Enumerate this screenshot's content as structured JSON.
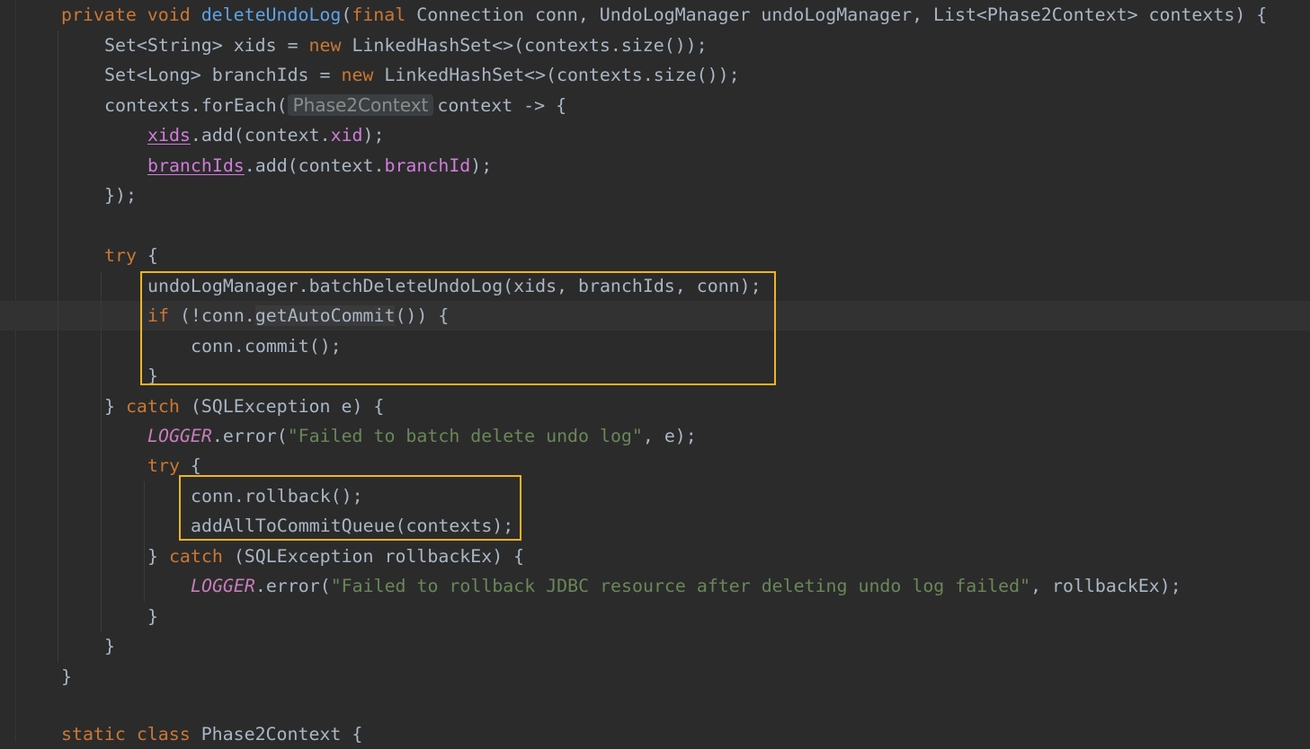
{
  "lines": {
    "l1": {
      "p1": "private void ",
      "p2": "deleteUndoLog",
      "p3": "(",
      "p4": "final ",
      "p5": "Connection conn, UndoLogManager undoLogManager, List<Phase2Context> contexts) {"
    },
    "l2": {
      "p1": "Set<String> xids = ",
      "p2": "new ",
      "p3": "LinkedHashSet<>(contexts.size());"
    },
    "l3": {
      "p1": "Set<Long> branchIds = ",
      "p2": "new ",
      "p3": "LinkedHashSet<>(contexts.size());"
    },
    "l4": {
      "p1": "contexts.forEach(",
      "hint": "Phase2Context",
      "p2": "context -> {"
    },
    "l5": {
      "p1": "xids",
      "p2": ".add(context.",
      "p3": "xid",
      "p4": ");"
    },
    "l6": {
      "p1": "branchIds",
      "p2": ".add(context.",
      "p3": "branchId",
      "p4": ");"
    },
    "l7": {
      "p1": "});"
    },
    "l9": {
      "p1": "try ",
      "p2": "{"
    },
    "l10": {
      "p1": "undoLogManager.batchDeleteUndoLog(xids, branchIds, conn);"
    },
    "l11": {
      "p1": "if ",
      "p2": "(!conn.",
      "p3": "getAutoCommit",
      "p4": "()) {"
    },
    "l12": {
      "p1": "conn.commit();"
    },
    "l13": {
      "p1": "}"
    },
    "l14": {
      "p1": "} ",
      "p2": "catch ",
      "p3": "(SQLException e) {"
    },
    "l15": {
      "p1": "LOGGER",
      "p2": ".error(",
      "p3": "\"Failed to batch delete undo log\"",
      "p4": ", e);"
    },
    "l16": {
      "p1": "try ",
      "p2": "{"
    },
    "l17": {
      "p1": "conn.rollback();"
    },
    "l18": {
      "p1": "addAllToCommitQueue(contexts);"
    },
    "l19": {
      "p1": "} ",
      "p2": "catch ",
      "p3": "(SQLException rollbackEx) {"
    },
    "l20": {
      "p1": "LOGGER",
      "p2": ".error(",
      "p3": "\"Failed to rollback JDBC resource after deleting undo log failed\"",
      "p4": ", rollbackEx);"
    },
    "l21": {
      "p1": "}"
    },
    "l22": {
      "p1": "}"
    },
    "l23": {
      "p1": "}"
    },
    "l25": {
      "p1": "static class ",
      "p2": "Phase2Context {"
    }
  },
  "colors": {
    "background": "#2b2b2b",
    "keyword": "#cc7832",
    "method_declaration": "#5fa3e8",
    "field": "#d07ddb",
    "string": "#6a8759",
    "highlight_box": "#f0b323"
  }
}
